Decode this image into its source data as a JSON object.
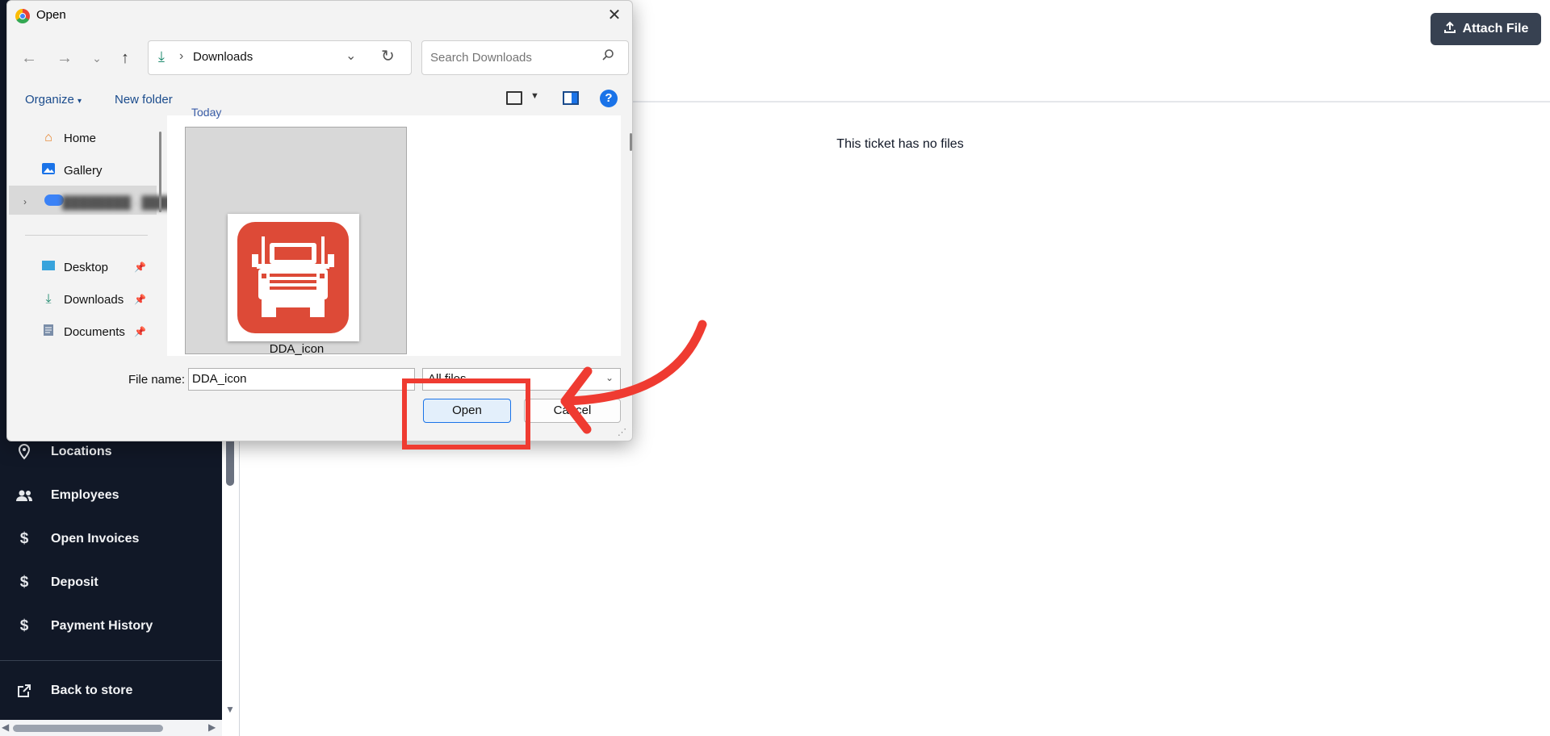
{
  "app": {
    "header": {
      "attach_label": "Attach File"
    },
    "empty_state": "This ticket has no files",
    "sidebar": {
      "items": [
        {
          "label": "Locations",
          "icon": "location-pin-icon"
        },
        {
          "label": "Employees",
          "icon": "people-icon"
        },
        {
          "label": "Open Invoices",
          "icon": "dollar-icon"
        },
        {
          "label": "Deposit",
          "icon": "dollar-icon"
        },
        {
          "label": "Payment History",
          "icon": "dollar-icon"
        }
      ],
      "footer_item": {
        "label": "Back to store",
        "icon": "external-link-icon"
      }
    }
  },
  "dialog": {
    "title": "Open",
    "address": {
      "location": "Downloads"
    },
    "search_placeholder": "Search Downloads",
    "commands": {
      "organize": "Organize",
      "new_folder": "New folder"
    },
    "nav": {
      "top": [
        {
          "label": "Home",
          "icon": "home-icon"
        },
        {
          "label": "Gallery",
          "icon": "gallery-icon"
        }
      ],
      "pinned": [
        {
          "label": "Desktop",
          "icon": "desktop-icon"
        },
        {
          "label": "Downloads",
          "icon": "download-icon"
        },
        {
          "label": "Documents",
          "icon": "documents-icon"
        }
      ]
    },
    "group_label": "Today",
    "file": {
      "name": "DDA_icon"
    },
    "file_name_label": "File name:",
    "file_name_value": "DDA_icon",
    "file_type": "All files",
    "open_label": "Open",
    "cancel_label": "Cancel"
  },
  "annotation": {
    "color": "#ef3b31"
  }
}
